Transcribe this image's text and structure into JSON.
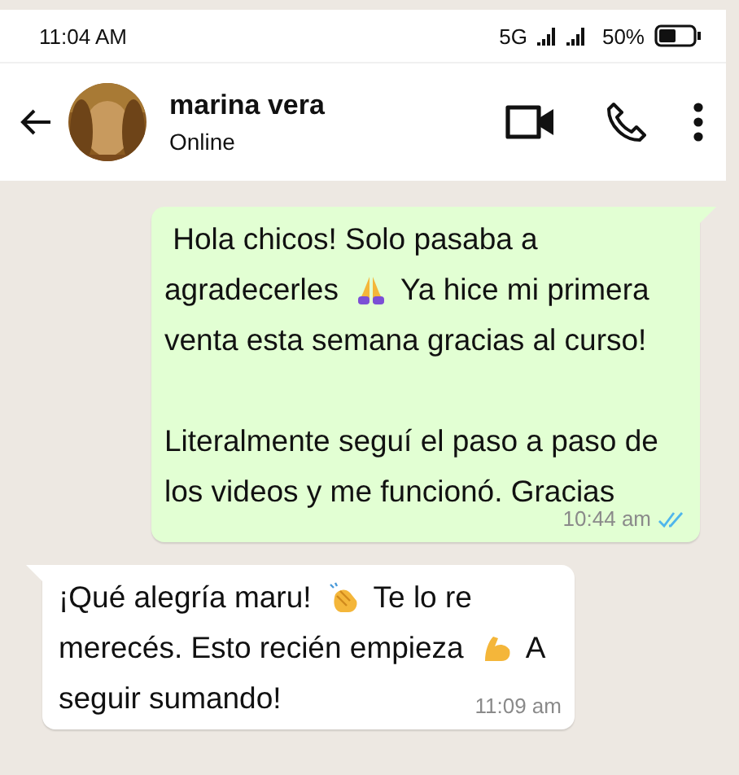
{
  "status_bar": {
    "time": "11:04 AM",
    "network": "5G",
    "battery": "50%"
  },
  "header": {
    "name": "marina vera",
    "status": "Online"
  },
  "messages": [
    {
      "kind": "sent",
      "paragraphs": [
        [
          [
            {
              "text": " Hola chicos! Solo pasaba a"
            }
          ],
          [
            {
              "text": "agradecerles"
            },
            {
              "kind": "emoji"
            },
            {
              "text": "Ya hice mi primera"
            }
          ],
          [
            {
              "text": "venta esta semana gracias al curso!"
            }
          ]
        ],
        [
          [
            {
              "text": "Literalmente seguí el paso a paso de"
            }
          ],
          [
            {
              "text": "los videos y me funcionó. Gracias"
            }
          ]
        ]
      ],
      "time": "10:44 am",
      "read": true
    },
    {
      "kind": "received",
      "paragraphs": [
        [
          [
            {
              "text": "¡Qué alegría maru!"
            },
            {
              "kind": "emoji"
            },
            {
              "text": "Te lo re"
            }
          ],
          [
            {
              "text": "merecés. Esto recién empieza"
            },
            {
              "kind": "emoji"
            },
            {
              "text": "A"
            }
          ],
          [
            {
              "text": "seguir sumando!"
            }
          ]
        ]
      ],
      "time": "11:09 am"
    }
  ]
}
